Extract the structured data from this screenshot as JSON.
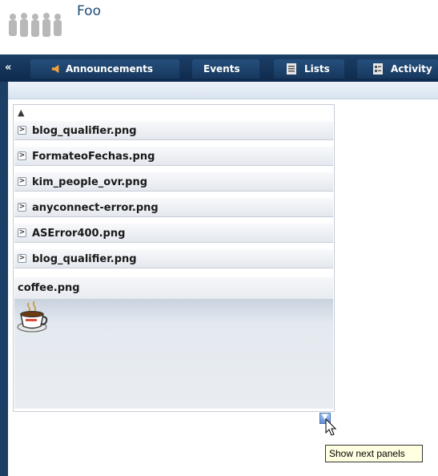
{
  "header": {
    "title": "Foo",
    "logo_icon": "people-silhouettes-icon"
  },
  "tabs": [
    {
      "label": "Announcements",
      "icon": "megaphone-icon"
    },
    {
      "label": "Events",
      "icon": ""
    },
    {
      "label": "Lists",
      "icon": "list-icon"
    },
    {
      "label": "Activity",
      "icon": "activity-icon"
    }
  ],
  "panel": {
    "collapsed_items": [
      {
        "label": "blog_qualifier.png"
      },
      {
        "label": "FormateoFechas.png"
      },
      {
        "label": "kim_people_ovr.png"
      },
      {
        "label": "anyconnect-error.png"
      },
      {
        "label": "ASError400.png"
      },
      {
        "label": "blog_qualifier.png"
      }
    ],
    "open_item": {
      "label": "coffee.png",
      "thumbnail_icon": "coffee-cup-icon"
    }
  },
  "tooltip": {
    "text": "Show next panels"
  },
  "colors": {
    "tabbar": "#1c3f66",
    "title": "#1f4b7a",
    "tooltip_bg": "#ffffe1"
  }
}
